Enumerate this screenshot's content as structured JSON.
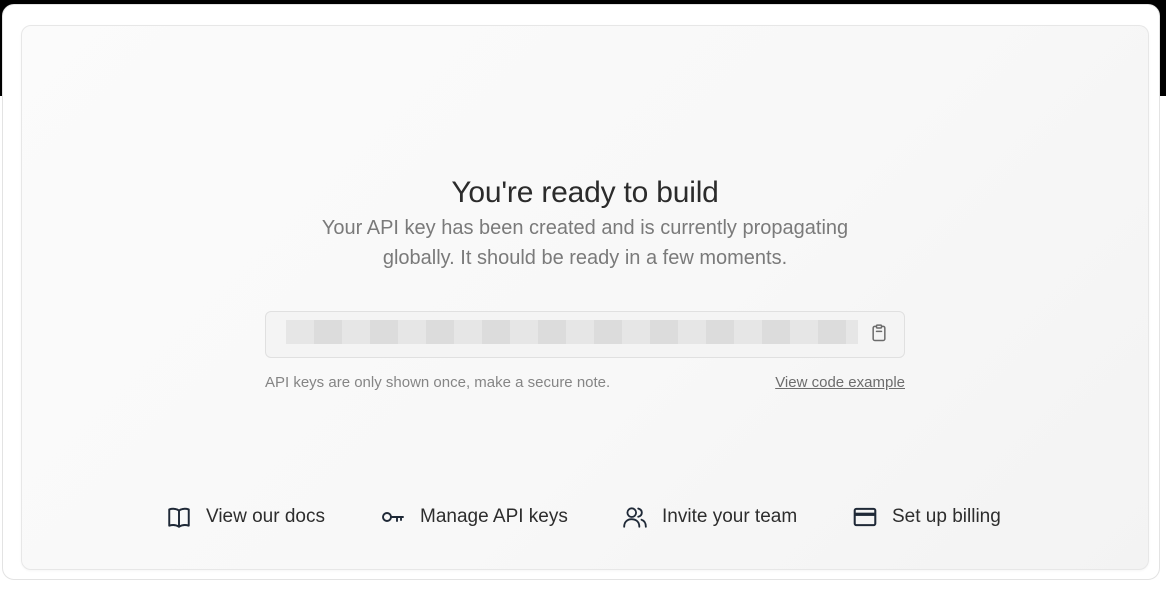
{
  "hero": {
    "title": "You're ready to build",
    "subtitle_line1": "Your API key has been created and is currently propagating",
    "subtitle_line2": "globally. It should be ready in a few moments."
  },
  "api_key": {
    "masked": true,
    "copy_icon": "clipboard-icon"
  },
  "notes": {
    "warning": "API keys are only shown once, make a secure note.",
    "code_link": "View code example"
  },
  "actions": [
    {
      "label": "View our docs",
      "icon": "book-icon"
    },
    {
      "label": "Manage API keys",
      "icon": "key-icon"
    },
    {
      "label": "Invite your team",
      "icon": "users-icon"
    },
    {
      "label": "Set up billing",
      "icon": "credit-card-icon"
    }
  ],
  "colors": {
    "top_bar": "#000000",
    "title": "#2b2b2b",
    "subtitle": "#7a7a7a",
    "card_bg": "#f8f8f8"
  }
}
